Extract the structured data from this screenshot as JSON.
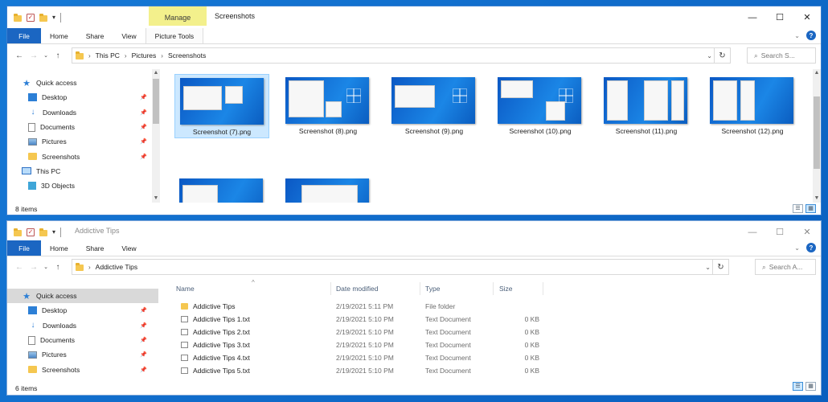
{
  "window1": {
    "title": "Screenshots",
    "manage_tab": "Manage",
    "ribbon_tabs": [
      "File",
      "Home",
      "Share",
      "View",
      "Picture Tools"
    ],
    "breadcrumb": [
      "This PC",
      "Pictures",
      "Screenshots"
    ],
    "search_placeholder": "Search S...",
    "nav_items": [
      {
        "label": "Quick access",
        "icon": "star-icon"
      },
      {
        "label": "Desktop",
        "icon": "desktop-icon",
        "pinned": true
      },
      {
        "label": "Downloads",
        "icon": "download-arrow-icon",
        "pinned": true
      },
      {
        "label": "Documents",
        "icon": "document-icon",
        "pinned": true
      },
      {
        "label": "Pictures",
        "icon": "pictures-icon",
        "pinned": true
      },
      {
        "label": "Screenshots",
        "icon": "folder-icon",
        "pinned": true
      },
      {
        "label": "This PC",
        "icon": "computer-icon"
      },
      {
        "label": "3D Objects",
        "icon": "cube-icon"
      }
    ],
    "files": [
      "Screenshot (7).png",
      "Screenshot (8).png",
      "Screenshot (9).png",
      "Screenshot (10).png",
      "Screenshot (11).png",
      "Screenshot (12).png",
      "",
      ""
    ],
    "status": "8 items"
  },
  "window2": {
    "title": "Addictive Tips",
    "ribbon_tabs": [
      "File",
      "Home",
      "Share",
      "View"
    ],
    "breadcrumb": [
      "Addictive Tips"
    ],
    "search_placeholder": "Search A...",
    "nav_items": [
      {
        "label": "Quick access",
        "icon": "star-icon"
      },
      {
        "label": "Desktop",
        "icon": "desktop-icon",
        "pinned": true
      },
      {
        "label": "Downloads",
        "icon": "download-arrow-icon",
        "pinned": true
      },
      {
        "label": "Documents",
        "icon": "document-icon",
        "pinned": true
      },
      {
        "label": "Pictures",
        "icon": "pictures-icon",
        "pinned": true
      },
      {
        "label": "Screenshots",
        "icon": "folder-icon",
        "pinned": true
      }
    ],
    "columns": {
      "name": "Name",
      "date": "Date modified",
      "type": "Type",
      "size": "Size"
    },
    "rows": [
      {
        "name": "Addictive Tips",
        "date": "2/19/2021 5:11 PM",
        "type": "File folder",
        "size": ""
      },
      {
        "name": "Addictive Tips 1.txt",
        "date": "2/19/2021 5:10 PM",
        "type": "Text Document",
        "size": "0 KB"
      },
      {
        "name": "Addictive Tips 2.txt",
        "date": "2/19/2021 5:10 PM",
        "type": "Text Document",
        "size": "0 KB"
      },
      {
        "name": "Addictive Tips 3.txt",
        "date": "2/19/2021 5:10 PM",
        "type": "Text Document",
        "size": "0 KB"
      },
      {
        "name": "Addictive Tips 4.txt",
        "date": "2/19/2021 5:10 PM",
        "type": "Text Document",
        "size": "0 KB"
      },
      {
        "name": "Addictive Tips 5.txt",
        "date": "2/19/2021 5:10 PM",
        "type": "Text Document",
        "size": "0 KB"
      }
    ],
    "status": "6 items"
  },
  "colors": {
    "accent": "#1b66c2",
    "manage": "#f3f08c",
    "desktop": "#0a67c9"
  }
}
